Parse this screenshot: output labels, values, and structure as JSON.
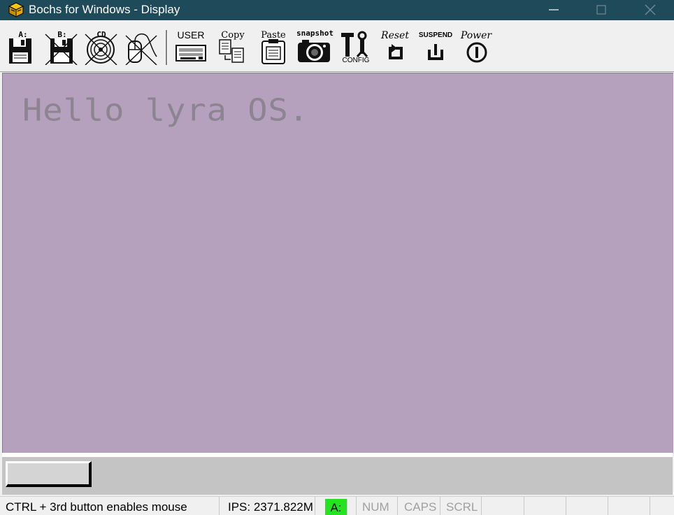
{
  "window": {
    "title": "Bochs for Windows - Display",
    "icon": "bochs-cube-icon"
  },
  "toolbar": {
    "floppy_a_label": "A:",
    "floppy_b_label": "B:",
    "cdrom_label": "CD",
    "user_label": "USER",
    "copy_label": "Copy",
    "paste_label": "Paste",
    "snapshot_label": "snapshot",
    "config_label": "CONFIG",
    "reset_label": "Reset",
    "suspend_label": "SUSPEND",
    "power_label": "Power"
  },
  "screen": {
    "text": "Hello lyra OS.",
    "background": "#b5a0bd",
    "text_color": "#8c8490"
  },
  "statusbar": {
    "mouse_hint": "CTRL + 3rd button enables mouse",
    "ips": "IPS: 2371.822M",
    "drive_a": "A:",
    "num": "NUM",
    "caps": "CAPS",
    "scrl": "SCRL"
  }
}
